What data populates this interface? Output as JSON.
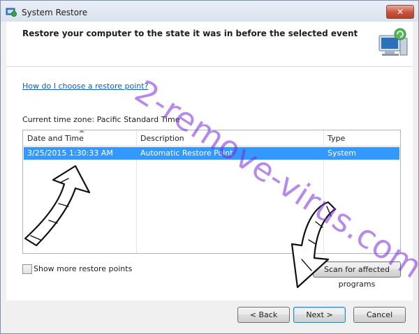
{
  "window": {
    "title": "System Restore",
    "close_label": "✕"
  },
  "header": {
    "title": "Restore your computer to the state it was in before the selected event"
  },
  "help_link": "How do I choose a restore point?",
  "timezone_label": "Current time zone: Pacific Standard Time",
  "table": {
    "columns": [
      "Date and Time",
      "Description",
      "Type"
    ],
    "rows": [
      {
        "date": "3/25/2015 1:30:33 AM",
        "description": "Automatic Restore Point",
        "type": "System"
      }
    ]
  },
  "show_more_label": "Show more restore points",
  "scan_button": "Scan for affected programs",
  "footer": {
    "back": "< Back",
    "next": "Next >",
    "cancel": "Cancel"
  },
  "watermark": "2-remove-virus.com",
  "colors": {
    "selection": "#3399ff",
    "link": "#0b5fb3",
    "watermark": "#7a2bd8"
  },
  "icons": [
    "system-restore-icon",
    "restore-computer-icon",
    "close-icon",
    "sort-arrow-icon"
  ]
}
